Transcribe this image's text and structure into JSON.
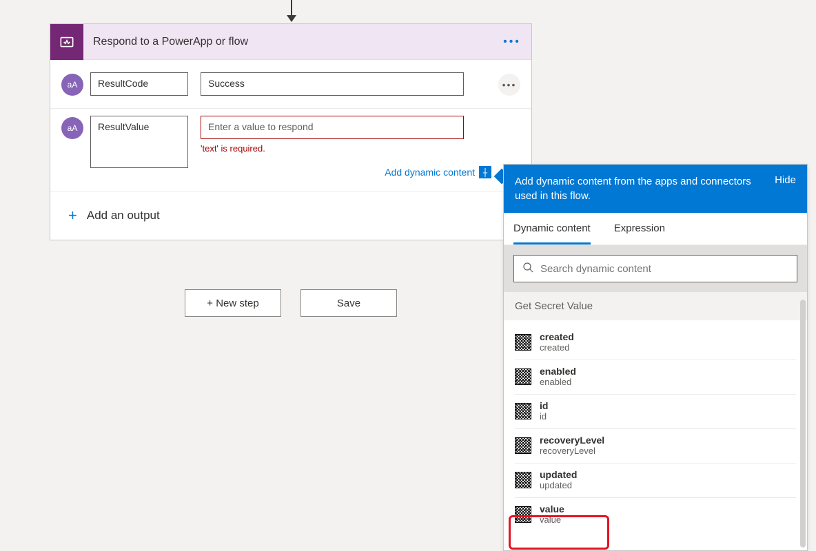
{
  "card": {
    "title": "Respond to a PowerApp or flow",
    "outputs": [
      {
        "type_badge": "aA",
        "name": "ResultCode",
        "value": "Success",
        "has_error": false
      },
      {
        "type_badge": "aA",
        "name": "ResultValue",
        "value": "",
        "placeholder": "Enter a value to respond",
        "error": "'text' is required.",
        "has_error": true
      }
    ],
    "add_dynamic": "Add dynamic content",
    "add_output": "Add an output"
  },
  "buttons": {
    "new_step": "+ New step",
    "save": "Save"
  },
  "panel": {
    "message": "Add dynamic content from the apps and connectors used in this flow.",
    "hide": "Hide",
    "tabs": {
      "dynamic": "Dynamic content",
      "expression": "Expression"
    },
    "search_placeholder": "Search dynamic content",
    "section": "Get Secret Value",
    "items": [
      {
        "name": "created",
        "desc": "created"
      },
      {
        "name": "enabled",
        "desc": "enabled"
      },
      {
        "name": "id",
        "desc": "id"
      },
      {
        "name": "recoveryLevel",
        "desc": "recoveryLevel"
      },
      {
        "name": "updated",
        "desc": "updated"
      },
      {
        "name": "value",
        "desc": "value"
      }
    ]
  }
}
